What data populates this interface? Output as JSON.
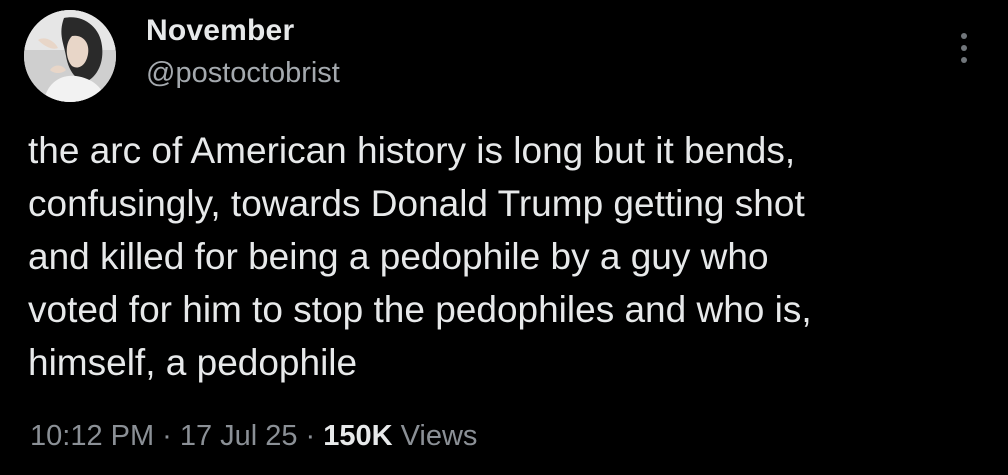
{
  "author": {
    "display_name": "November",
    "handle": "@postoctobrist",
    "avatar_icon": "profile-photo"
  },
  "menu": {
    "icon": "vertical-ellipsis-icon"
  },
  "tweet": {
    "text": "the arc of American history is long but it bends,\nconfusingly, towards Donald Trump getting shot\nand killed for being a pedophile by a guy who\nvoted for him to stop the pedophiles and who is,\nhimself, a pedophile"
  },
  "meta": {
    "time": "10:12 PM",
    "separator": "·",
    "date": "17 Jul 25",
    "views_count": "150K",
    "views_label": "Views"
  },
  "colors": {
    "background": "#000000",
    "primary_text": "#e7e9ea",
    "secondary_text": "#8b9096"
  }
}
